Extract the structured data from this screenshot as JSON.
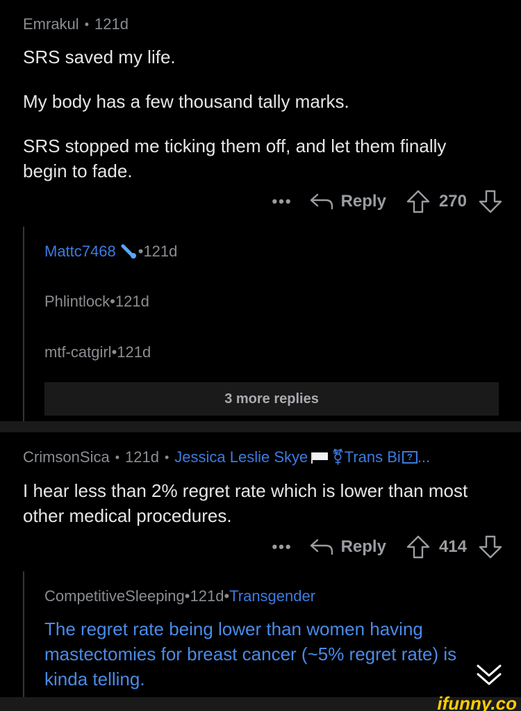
{
  "comment1": {
    "author": "Emrakul",
    "age": "121d",
    "paragraphs": [
      "SRS saved my life.",
      "My body has a few thousand tally marks.",
      "SRS stopped me ticking them off, and let them finally begin to fade."
    ],
    "reply_label": "Reply",
    "score": "270",
    "more_label": "•••"
  },
  "replies": [
    {
      "author": "Mattc7468",
      "age": "121d"
    },
    {
      "author": "Phlintlock",
      "age": "121d"
    },
    {
      "author": "mtf-catgirl",
      "age": "121d"
    }
  ],
  "more_replies_label": "3 more replies",
  "comment2": {
    "author": "CrimsonSica",
    "age": "121d",
    "flair": "Jessica Leslie Skye",
    "flair2": "Trans Bi",
    "flair_box": "?",
    "flair_ellipsis": "...",
    "text": "I hear less than 2% regret rate which is lower than most other medical procedures.",
    "reply_label": "Reply",
    "score": "414",
    "more_label": "•••"
  },
  "comment3": {
    "author": "CompetitiveSleeping",
    "age": "121d",
    "flair": "Transgender",
    "text": "The regret rate being lower than women having mastectomies for breast cancer (~5% regret rate) is kinda telling."
  },
  "watermark": "ifunny.co",
  "colors": {
    "background": "#000000",
    "accent": "#3d7be0",
    "meta": "#8a8d91"
  }
}
